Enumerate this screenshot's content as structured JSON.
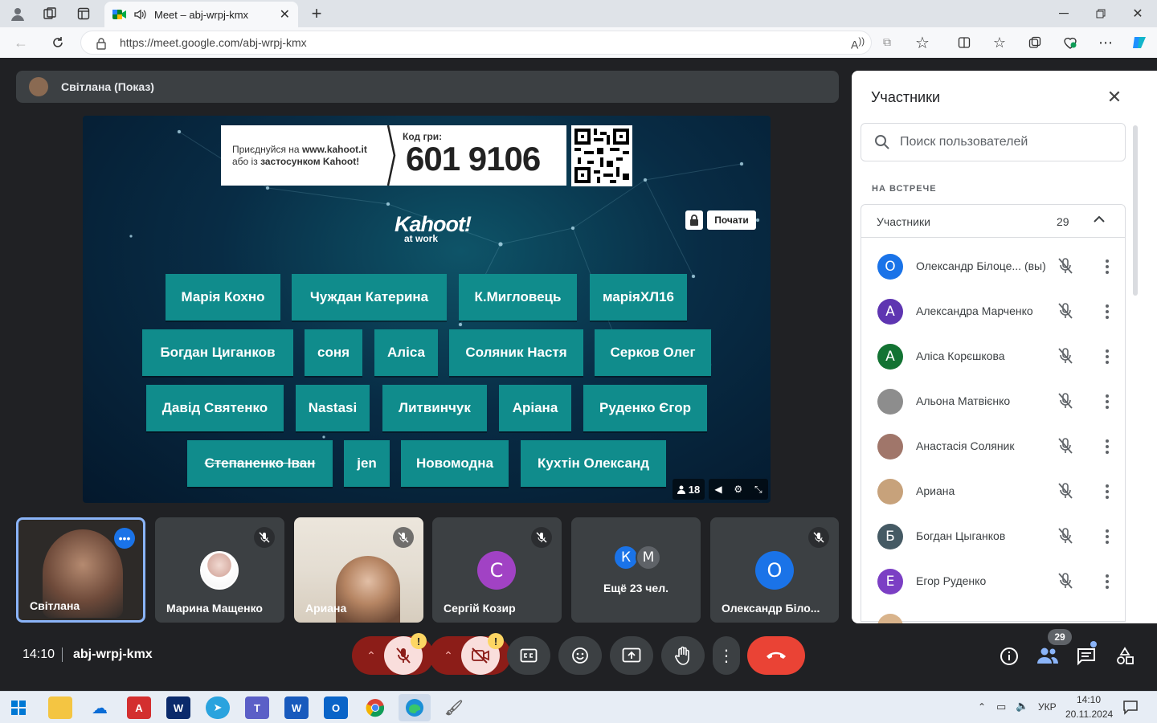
{
  "browser": {
    "tab_title": "Meet – abj-wrpj-kmx",
    "url": "https://meet.google.com/abj-wrpj-kmx"
  },
  "presenter": {
    "label": "Світлана (Показ)"
  },
  "kahoot": {
    "join_line1_prefix": "Приєднуйся на ",
    "join_site": "www.kahoot.it",
    "join_line2_prefix": "або із ",
    "join_app": "застосунком Kahoot!",
    "game_code_label": "Код гри:",
    "game_code": "601 9106",
    "logo": "Kahoot!",
    "logo_sub": "at work",
    "start_button": "Почати",
    "player_count": "18",
    "players": [
      "Марія Кохно",
      "Чуждан Катерина",
      "К.Мигловець",
      "маріяХЛ16",
      "Богдан Циганков",
      "соня",
      "Аліса",
      "Соляник Настя",
      "Серков Олег",
      "Давід Святенко",
      "Nastasi",
      "Литвинчук",
      "Аріана",
      "Руденко Єгор",
      "Степаненко Іван",
      "jen",
      "Новомодна",
      "Кухтін Олександ"
    ]
  },
  "tiles": [
    {
      "label": "Світлана"
    },
    {
      "label": "Марина Мащенко"
    },
    {
      "label": "Ариана"
    },
    {
      "label": "Сергій Козир",
      "initial": "С"
    },
    {
      "label": "Ещё 23 чел.",
      "i1": "К",
      "i2": "М"
    },
    {
      "label": "Олександр Біло...",
      "initial": "О"
    }
  ],
  "meeting": {
    "time": "14:10",
    "code": "abj-wrpj-kmx",
    "participants_badge": "29"
  },
  "panel": {
    "title": "Участники",
    "search_placeholder": "Поиск пользователей",
    "section": "НА ВСТРЕЧЕ",
    "group_label": "Участники",
    "group_count": "29",
    "people": [
      {
        "name": "Олександр Білоце... (вы)",
        "initial": "О",
        "color": "#1a73e8"
      },
      {
        "name": "Александра Марченко",
        "initial": "А",
        "color": "#5e35b1"
      },
      {
        "name": "Аліса Корєшкова",
        "initial": "А",
        "color": "#137333"
      },
      {
        "name": "Альона Матвієнко",
        "initial": "",
        "color": "#8d8d8d"
      },
      {
        "name": "Анастасія Соляник",
        "initial": "",
        "color": "#a0766a"
      },
      {
        "name": "Ариана",
        "initial": "",
        "color": "#c7a27b"
      },
      {
        "name": "Богдан Цыганков",
        "initial": "Б",
        "color": "#455a64"
      },
      {
        "name": "Егор Руденко",
        "initial": "Е",
        "color": "#7b3fc4"
      }
    ]
  },
  "taskbar": {
    "lang": "УКР",
    "time": "14:10",
    "date": "20.11.2024"
  }
}
